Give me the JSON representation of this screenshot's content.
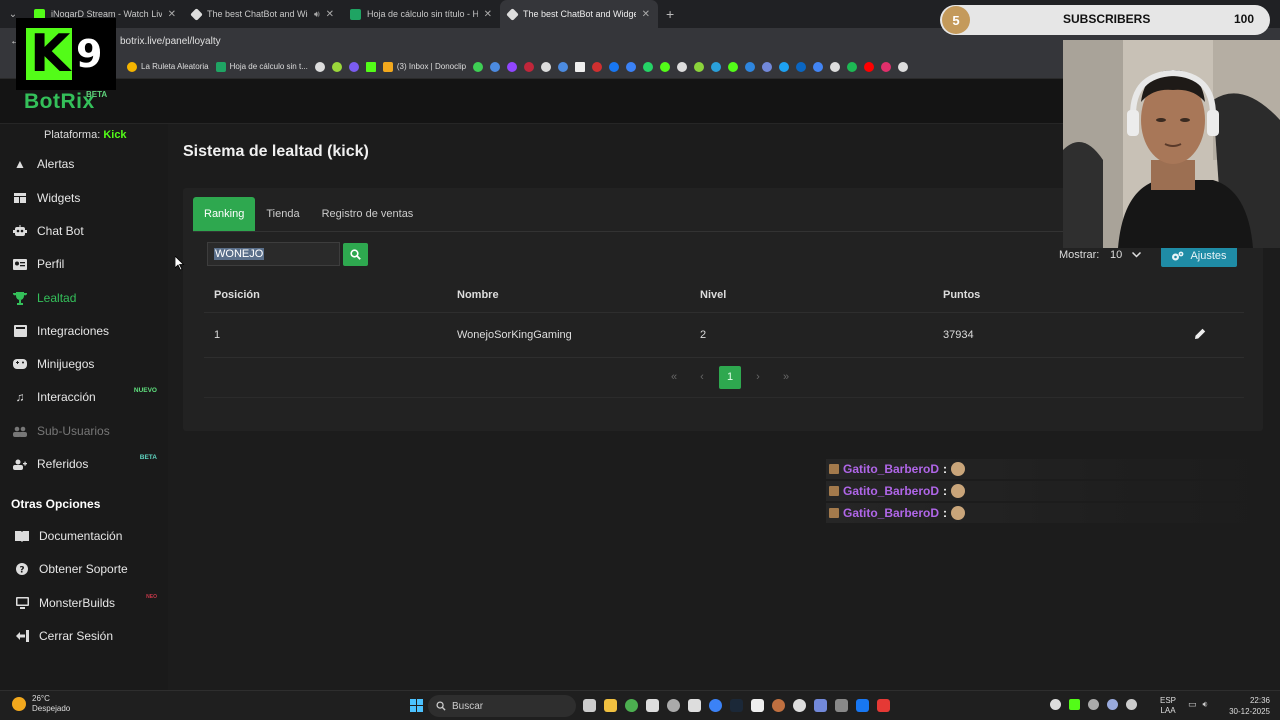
{
  "browser": {
    "tabs": [
      {
        "title": "iNoqarD Stream - Watch Live o",
        "favicon_color": "#53fc18"
      },
      {
        "title": "The best ChatBot and Widg",
        "favicon_color": "#dddddd"
      },
      {
        "title": "Hoja de cálculo sin título - Hoja",
        "favicon_color": "#1fa463"
      },
      {
        "title": "The best ChatBot and Widgets",
        "favicon_color": "#dddddd"
      }
    ],
    "url": "botrix.live/panel/loyalty",
    "bookmarks": [
      {
        "label": "La Ruleta Aleatoria",
        "color": "#f4b400"
      },
      {
        "label": "Hoja de cálculo sin t...",
        "color": "#1fa463"
      },
      {
        "label": "(3) Inbox | Donoclip",
        "color": "#f2a81d"
      }
    ]
  },
  "overlay": {
    "k9_letter": "K",
    "k9_number": "9",
    "subscribers_goal": "5",
    "subscribers_label": "SUBSCRIBERS",
    "subscribers_count": "100"
  },
  "brand": {
    "name": "BotRix",
    "badge": "BETA"
  },
  "sidebar": {
    "platform_label": "Plataforma:",
    "platform_value": "Kick",
    "items": [
      {
        "label": "Alertas",
        "icon": "warning-icon"
      },
      {
        "label": "Widgets",
        "icon": "grid-icon"
      },
      {
        "label": "Chat Bot",
        "icon": "robot-icon"
      },
      {
        "label": "Perfil",
        "icon": "id-card-icon"
      },
      {
        "label": "Lealtad",
        "icon": "trophy-icon",
        "active": true
      },
      {
        "label": "Integraciones",
        "icon": "plug-icon"
      },
      {
        "label": "Minijuegos",
        "icon": "gamepad-icon"
      },
      {
        "label": "Interacción",
        "icon": "music-icon",
        "badge": "NUEVO"
      },
      {
        "label": "Sub-Usuarios",
        "icon": "users-icon",
        "disabled": true
      },
      {
        "label": "Referidos",
        "icon": "user-plus-icon",
        "badge": "BETA"
      }
    ],
    "other_title": "Otras Opciones",
    "other_items": [
      {
        "label": "Documentación",
        "icon": "book-icon"
      },
      {
        "label": "Obtener Soporte",
        "icon": "question-icon"
      },
      {
        "label": "MonsterBuilds",
        "icon": "monitor-icon",
        "badge": "NEO"
      },
      {
        "label": "Cerrar Sesión",
        "icon": "logout-icon"
      }
    ]
  },
  "main": {
    "title": "Sistema de lealtad (kick)",
    "tabs": [
      "Ranking",
      "Tienda",
      "Registro de ventas"
    ],
    "search_value": "WONEJO",
    "show_label": "Mostrar:",
    "show_value": "10",
    "settings_label": "Ajustes",
    "columns": [
      "Posición",
      "Nombre",
      "Nivel",
      "Puntos"
    ],
    "rows": [
      {
        "position": "1",
        "name": "WonejoSorKingGaming",
        "level": "2",
        "points": "37934"
      }
    ],
    "pagination": {
      "first": "«",
      "prev": "‹",
      "current": "1",
      "next": "›",
      "last": "»"
    }
  },
  "chat": [
    {
      "user": "Gatito_BarberoD",
      "sep": ":"
    },
    {
      "user": "Gatito_BarberoD",
      "sep": ":"
    },
    {
      "user": "Gatito_BarberoD",
      "sep": ":"
    }
  ],
  "taskbar": {
    "temp": "26°C",
    "weather": "Despejado",
    "search_placeholder": "Buscar",
    "lang_top": "ESP",
    "lang_bottom": "LAA",
    "time": "22:36",
    "date": "30-12-2025"
  }
}
